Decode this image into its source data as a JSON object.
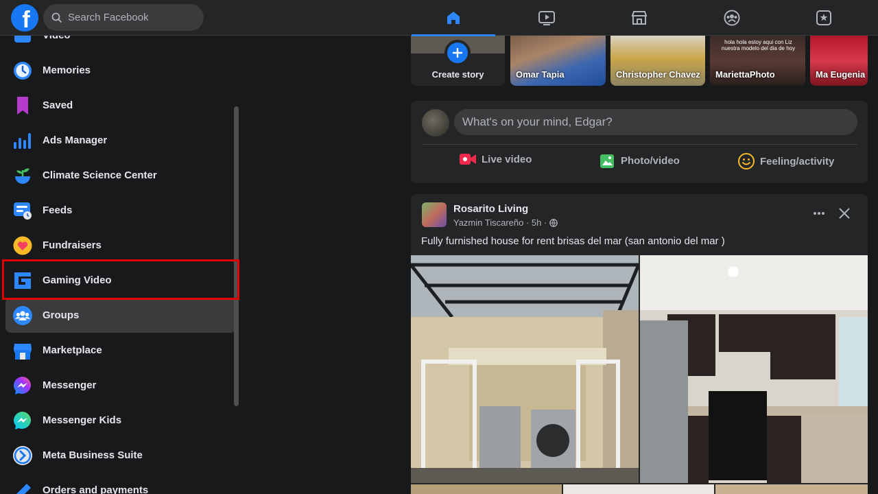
{
  "topbar": {
    "logo_letter": "f",
    "search_placeholder": "Search Facebook",
    "tabs": [
      "home-icon",
      "watch-icon",
      "marketplace-icon",
      "groups-icon",
      "gaming-icon"
    ]
  },
  "sidebar": {
    "items": [
      {
        "label": "Video"
      },
      {
        "label": "Memories"
      },
      {
        "label": "Saved"
      },
      {
        "label": "Ads Manager"
      },
      {
        "label": "Climate Science Center"
      },
      {
        "label": "Feeds"
      },
      {
        "label": "Fundraisers"
      },
      {
        "label": "Gaming Video"
      },
      {
        "label": "Groups"
      },
      {
        "label": "Marketplace"
      },
      {
        "label": "Messenger"
      },
      {
        "label": "Messenger Kids"
      },
      {
        "label": "Meta Business Suite"
      },
      {
        "label": "Orders and payments"
      }
    ]
  },
  "stories": {
    "create_label": "Create story",
    "items": [
      {
        "name": "Omar Tapia"
      },
      {
        "name": "Christopher Chavez"
      },
      {
        "name": "MariettaPhoto",
        "overlay_text": "hola hola estoy aqui con Liz nuestra modelo del dia de hoy"
      },
      {
        "name": "Ma Eugenia"
      }
    ]
  },
  "composer": {
    "placeholder": "What's on your mind, Edgar?",
    "live_label": "Live video",
    "photo_label": "Photo/video",
    "feeling_label": "Feeling/activity"
  },
  "post": {
    "group": "Rosarito Living",
    "author": "Yazmin Tiscareño",
    "time": "5h",
    "text": "Fully furnished house for rent brisas del mar (san antonio del mar )"
  },
  "colors": {
    "accent": "#2d88ff",
    "highlight_box": "#e00000",
    "live": "#f02849",
    "photo": "#45bd62",
    "feeling": "#f7b928"
  }
}
